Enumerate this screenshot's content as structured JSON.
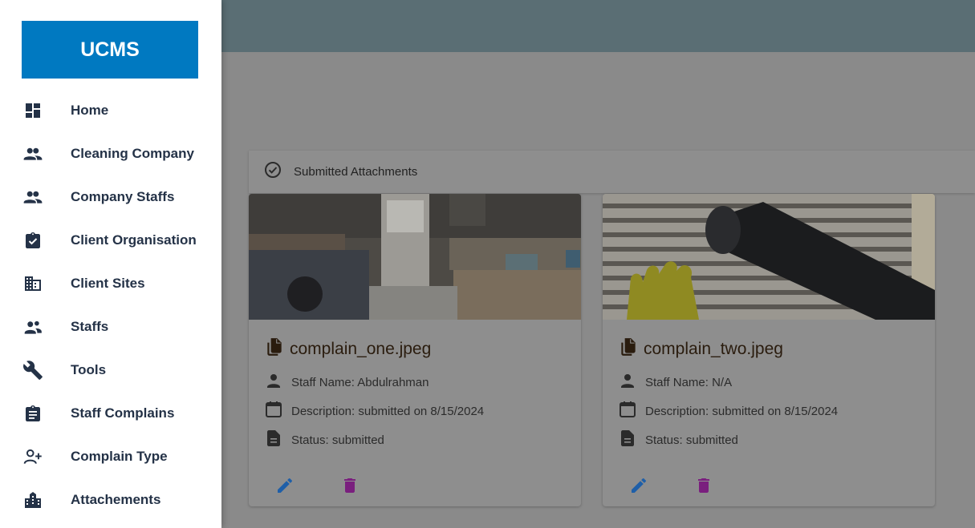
{
  "app": {
    "logo_text": "UCMS"
  },
  "sidebar": {
    "items": [
      {
        "label": "Home",
        "icon": "dashboard-icon"
      },
      {
        "label": "Cleaning Company",
        "icon": "people-icon"
      },
      {
        "label": "Company Staffs",
        "icon": "people-icon"
      },
      {
        "label": "Client Organisation",
        "icon": "assignment-check-icon"
      },
      {
        "label": "Client Sites",
        "icon": "building-icon"
      },
      {
        "label": "Staffs",
        "icon": "group-icon"
      },
      {
        "label": "Tools",
        "icon": "wrench-icon"
      },
      {
        "label": "Staff Complains",
        "icon": "clipboard-icon"
      },
      {
        "label": "Complain Type",
        "icon": "person-add-icon"
      },
      {
        "label": "Attachements",
        "icon": "city-icon"
      }
    ]
  },
  "section": {
    "title": "Submitted Attachments",
    "icon": "check-circle-icon"
  },
  "cards": [
    {
      "filename": "complain_one.jpeg",
      "staff": "Staff Name: Abdulrahman",
      "description": "Description: submitted on 8/15/2024",
      "status": "Status: submitted",
      "image": "kitchen-photo"
    },
    {
      "filename": "complain_two.jpeg",
      "staff": "Staff Name: N/A",
      "description": "Description: submitted on 8/15/2024",
      "status": "Status: submitted",
      "image": "vent-cleaning-photo"
    }
  ],
  "colors": {
    "brand": "#0079c1",
    "edit_icon": "#1f5fa8",
    "delete_icon": "#7a1f7e",
    "nav_text": "#243247"
  }
}
